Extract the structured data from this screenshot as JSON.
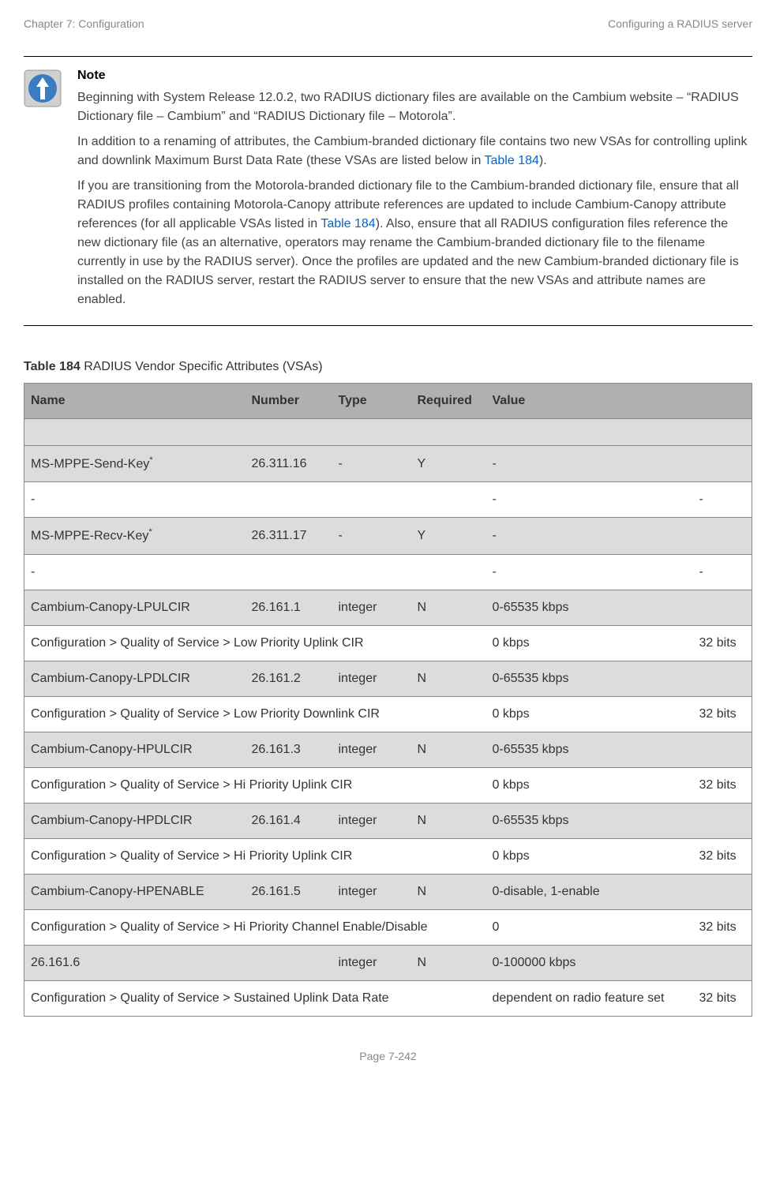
{
  "header": {
    "left": "Chapter 7:  Configuration",
    "right": "Configuring a RADIUS server"
  },
  "note": {
    "title": "Note",
    "para1_pre": "Beginning with System Release 12.0.2, two RADIUS dictionary files are available on the Cambium website – “RADIUS Dictionary file – Cambium” and “RADIUS Dictionary file – Motorola”.",
    "para2_pre": "In addition to a renaming of attributes, the Cambium-branded dictionary file contains two new VSAs for controlling uplink and downlink Maximum Burst Data Rate (these VSAs are listed below in ",
    "para2_link": "Table 184",
    "para2_post": ").",
    "para3_pre": "If you are transitioning from the Motorola-branded dictionary file to the Cambium-branded dictionary file, ensure that all RADIUS profiles containing Motorola-Canopy attribute references are updated to include Cambium-Canopy attribute references (for all applicable VSAs listed in ",
    "para3_link": "Table 184",
    "para3_post": "). Also, ensure that all RADIUS configuration files reference the new dictionary file (as an alternative, operators may rename the Cambium-branded dictionary file to the filename currently in use by the RADIUS server). Once the profiles are updated and the new Cambium-branded dictionary file is installed on the RADIUS server, restart the RADIUS server to ensure that the new VSAs and attribute names are enabled."
  },
  "table": {
    "caption_label": "Table 184",
    "caption_text": " RADIUS Vendor Specific Attributes (VSAs)",
    "headers": {
      "name": "Name",
      "number": "Number",
      "type": "Type",
      "required": "Required",
      "value": "Value"
    },
    "rows": [
      {
        "kind": "blank"
      },
      {
        "kind": "attr",
        "name": "MS-MPPE-Send-Key",
        "sup": "*",
        "number": "26.311.16",
        "type": "-",
        "required": "Y",
        "value": "-"
      },
      {
        "kind": "path",
        "path": "-",
        "default": "-",
        "size": "-"
      },
      {
        "kind": "attr",
        "name": "MS-MPPE-Recv-Key",
        "sup": "*",
        "number": "26.311.17",
        "type": "-",
        "required": "Y",
        "value": "-"
      },
      {
        "kind": "path",
        "path": "-",
        "default": "-",
        "size": "-"
      },
      {
        "kind": "attr",
        "name": "Cambium-Canopy-LPULCIR",
        "number": "26.161.1",
        "type": "integer",
        "required": "N",
        "value": "0-65535 kbps"
      },
      {
        "kind": "path",
        "path": "Configuration > Quality of Service > Low Priority Uplink CIR",
        "default": "0 kbps",
        "size": "32 bits"
      },
      {
        "kind": "attr",
        "name": "Cambium-Canopy-LPDLCIR",
        "number": "26.161.2",
        "type": "integer",
        "required": "N",
        "value": "0-65535 kbps"
      },
      {
        "kind": "path",
        "path": "Configuration > Quality of Service > Low Priority Downlink CIR",
        "default": "0 kbps",
        "size": "32 bits"
      },
      {
        "kind": "attr",
        "name": "Cambium-Canopy-HPULCIR",
        "number": "26.161.3",
        "type": "integer",
        "required": "N",
        "value": "0-65535 kbps"
      },
      {
        "kind": "path",
        "path": "Configuration > Quality of Service > Hi Priority Uplink CIR",
        "default": "0 kbps",
        "size": "32 bits"
      },
      {
        "kind": "attr",
        "name": "Cambium-Canopy-HPDLCIR",
        "number": "26.161.4",
        "type": "integer",
        "required": "N",
        "value": "0-65535 kbps"
      },
      {
        "kind": "path",
        "path": "Configuration > Quality of Service > Hi Priority Uplink CIR",
        "default": "0 kbps",
        "size": "32 bits"
      },
      {
        "kind": "attr",
        "name": "Cambium-Canopy-HPENABLE",
        "number": "26.161.5",
        "type": "integer",
        "required": "N",
        "value": "0-disable, 1-enable"
      },
      {
        "kind": "path",
        "path": "Configuration > Quality of Service > Hi Priority Channel Enable/Disable",
        "default": "0",
        "size": "32 bits"
      },
      {
        "kind": "attr",
        "name": "26.161.6",
        "number": "",
        "type": "integer",
        "required": "N",
        "value": "0-100000 kbps"
      },
      {
        "kind": "path",
        "path": "Configuration > Quality of Service > Sustained Uplink Data Rate",
        "default": "dependent on radio feature set",
        "size": "32 bits"
      }
    ]
  },
  "footer": {
    "page": "Page 7-242"
  }
}
